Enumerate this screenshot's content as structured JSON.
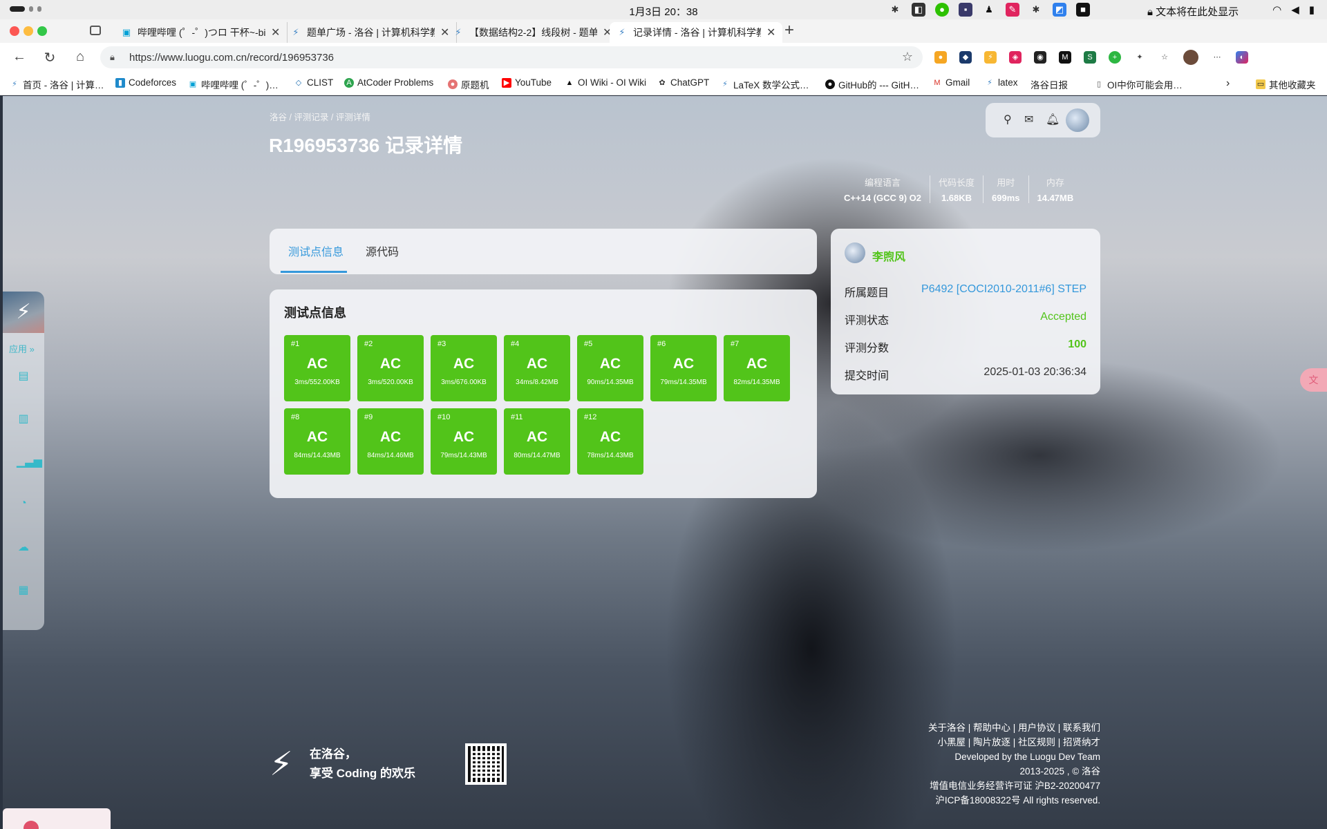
{
  "system": {
    "clock": "1月3日 20：38",
    "notice": "文本将在此处显示"
  },
  "tabs": [
    {
      "title": "哔哩哔哩 (゜-゜)つロ 干杯~-bili",
      "icon": "bilibili-icon"
    },
    {
      "title": "题单广场 - 洛谷 | 计算机科学教",
      "icon": "luogu-icon"
    },
    {
      "title": "【数据结构2-2】线段树 - 题单",
      "icon": "luogu-icon"
    },
    {
      "title": "记录详情 - 洛谷 | 计算机科学教",
      "icon": "luogu-icon",
      "active": true
    }
  ],
  "address": {
    "url": "https://www.luogu.com.cn/record/196953736"
  },
  "bookmarks": [
    "首页 - 洛谷 | 计算…",
    "Codeforces",
    "哔哩哔哩 (゜-゜)…",
    "CLIST",
    "AtCoder Problems",
    "原题机",
    "YouTube",
    "OI Wiki - OI Wiki",
    "ChatGPT",
    "LaTeX 数学公式…",
    "GitHub的 --- GitH…",
    "Gmail",
    "latex",
    "洛谷日报",
    "OI中你可能会用…"
  ],
  "bookmarks_other": "其他收藏夹",
  "breadcrumb": "洛谷 / 评测记录 / 评测详情",
  "title": "R196953736 记录详情",
  "stats": [
    {
      "label": "编程语言",
      "value": "C++14 (GCC 9) O2"
    },
    {
      "label": "代码长度",
      "value": "1.68KB"
    },
    {
      "label": "用时",
      "value": "699ms"
    },
    {
      "label": "内存",
      "value": "14.47MB"
    }
  ],
  "page_tabs": {
    "tests": "测试点信息",
    "source": "源代码"
  },
  "tests_heading": "测试点信息",
  "testcases": [
    {
      "no": "#1",
      "status": "AC",
      "info": "3ms/552.00KB"
    },
    {
      "no": "#2",
      "status": "AC",
      "info": "3ms/520.00KB"
    },
    {
      "no": "#3",
      "status": "AC",
      "info": "3ms/676.00KB"
    },
    {
      "no": "#4",
      "status": "AC",
      "info": "34ms/8.42MB"
    },
    {
      "no": "#5",
      "status": "AC",
      "info": "90ms/14.35MB"
    },
    {
      "no": "#6",
      "status": "AC",
      "info": "79ms/14.35MB"
    },
    {
      "no": "#7",
      "status": "AC",
      "info": "82ms/14.35MB"
    },
    {
      "no": "#8",
      "status": "AC",
      "info": "84ms/14.43MB"
    },
    {
      "no": "#9",
      "status": "AC",
      "info": "84ms/14.46MB"
    },
    {
      "no": "#10",
      "status": "AC",
      "info": "79ms/14.43MB"
    },
    {
      "no": "#11",
      "status": "AC",
      "info": "80ms/14.47MB"
    },
    {
      "no": "#12",
      "status": "AC",
      "info": "78ms/14.43MB"
    }
  ],
  "info": {
    "username": "李煦风",
    "problem_label": "所属题目",
    "problem": "P6492 [COCI2010-2011#6] STEP",
    "status_label": "评测状态",
    "status": "Accepted",
    "score_label": "评测分数",
    "score": "100",
    "time_label": "提交时间",
    "time": "2025-01-03 20:36:34"
  },
  "sidebar": {
    "apps": "应用"
  },
  "footer": {
    "slogan1": "在洛谷，",
    "slogan2": "享受 Coding 的欢乐",
    "line1": "关于洛谷 | 帮助中心 | 用户协议 | 联系我们",
    "line2": "小黑屋 | 陶片放逐 | 社区规则 | 招贤纳才",
    "line3": "Developed by the Luogu Dev Team",
    "line4": "2013-2025 , © 洛谷",
    "line5": "增值电信业务经营许可证 沪B2-20200477",
    "line6": "沪ICP备18008322号 All rights reserved."
  },
  "colors": {
    "accepted": "#52c41a",
    "link": "#3498db",
    "sidebar_icon": "#35b9c9"
  }
}
